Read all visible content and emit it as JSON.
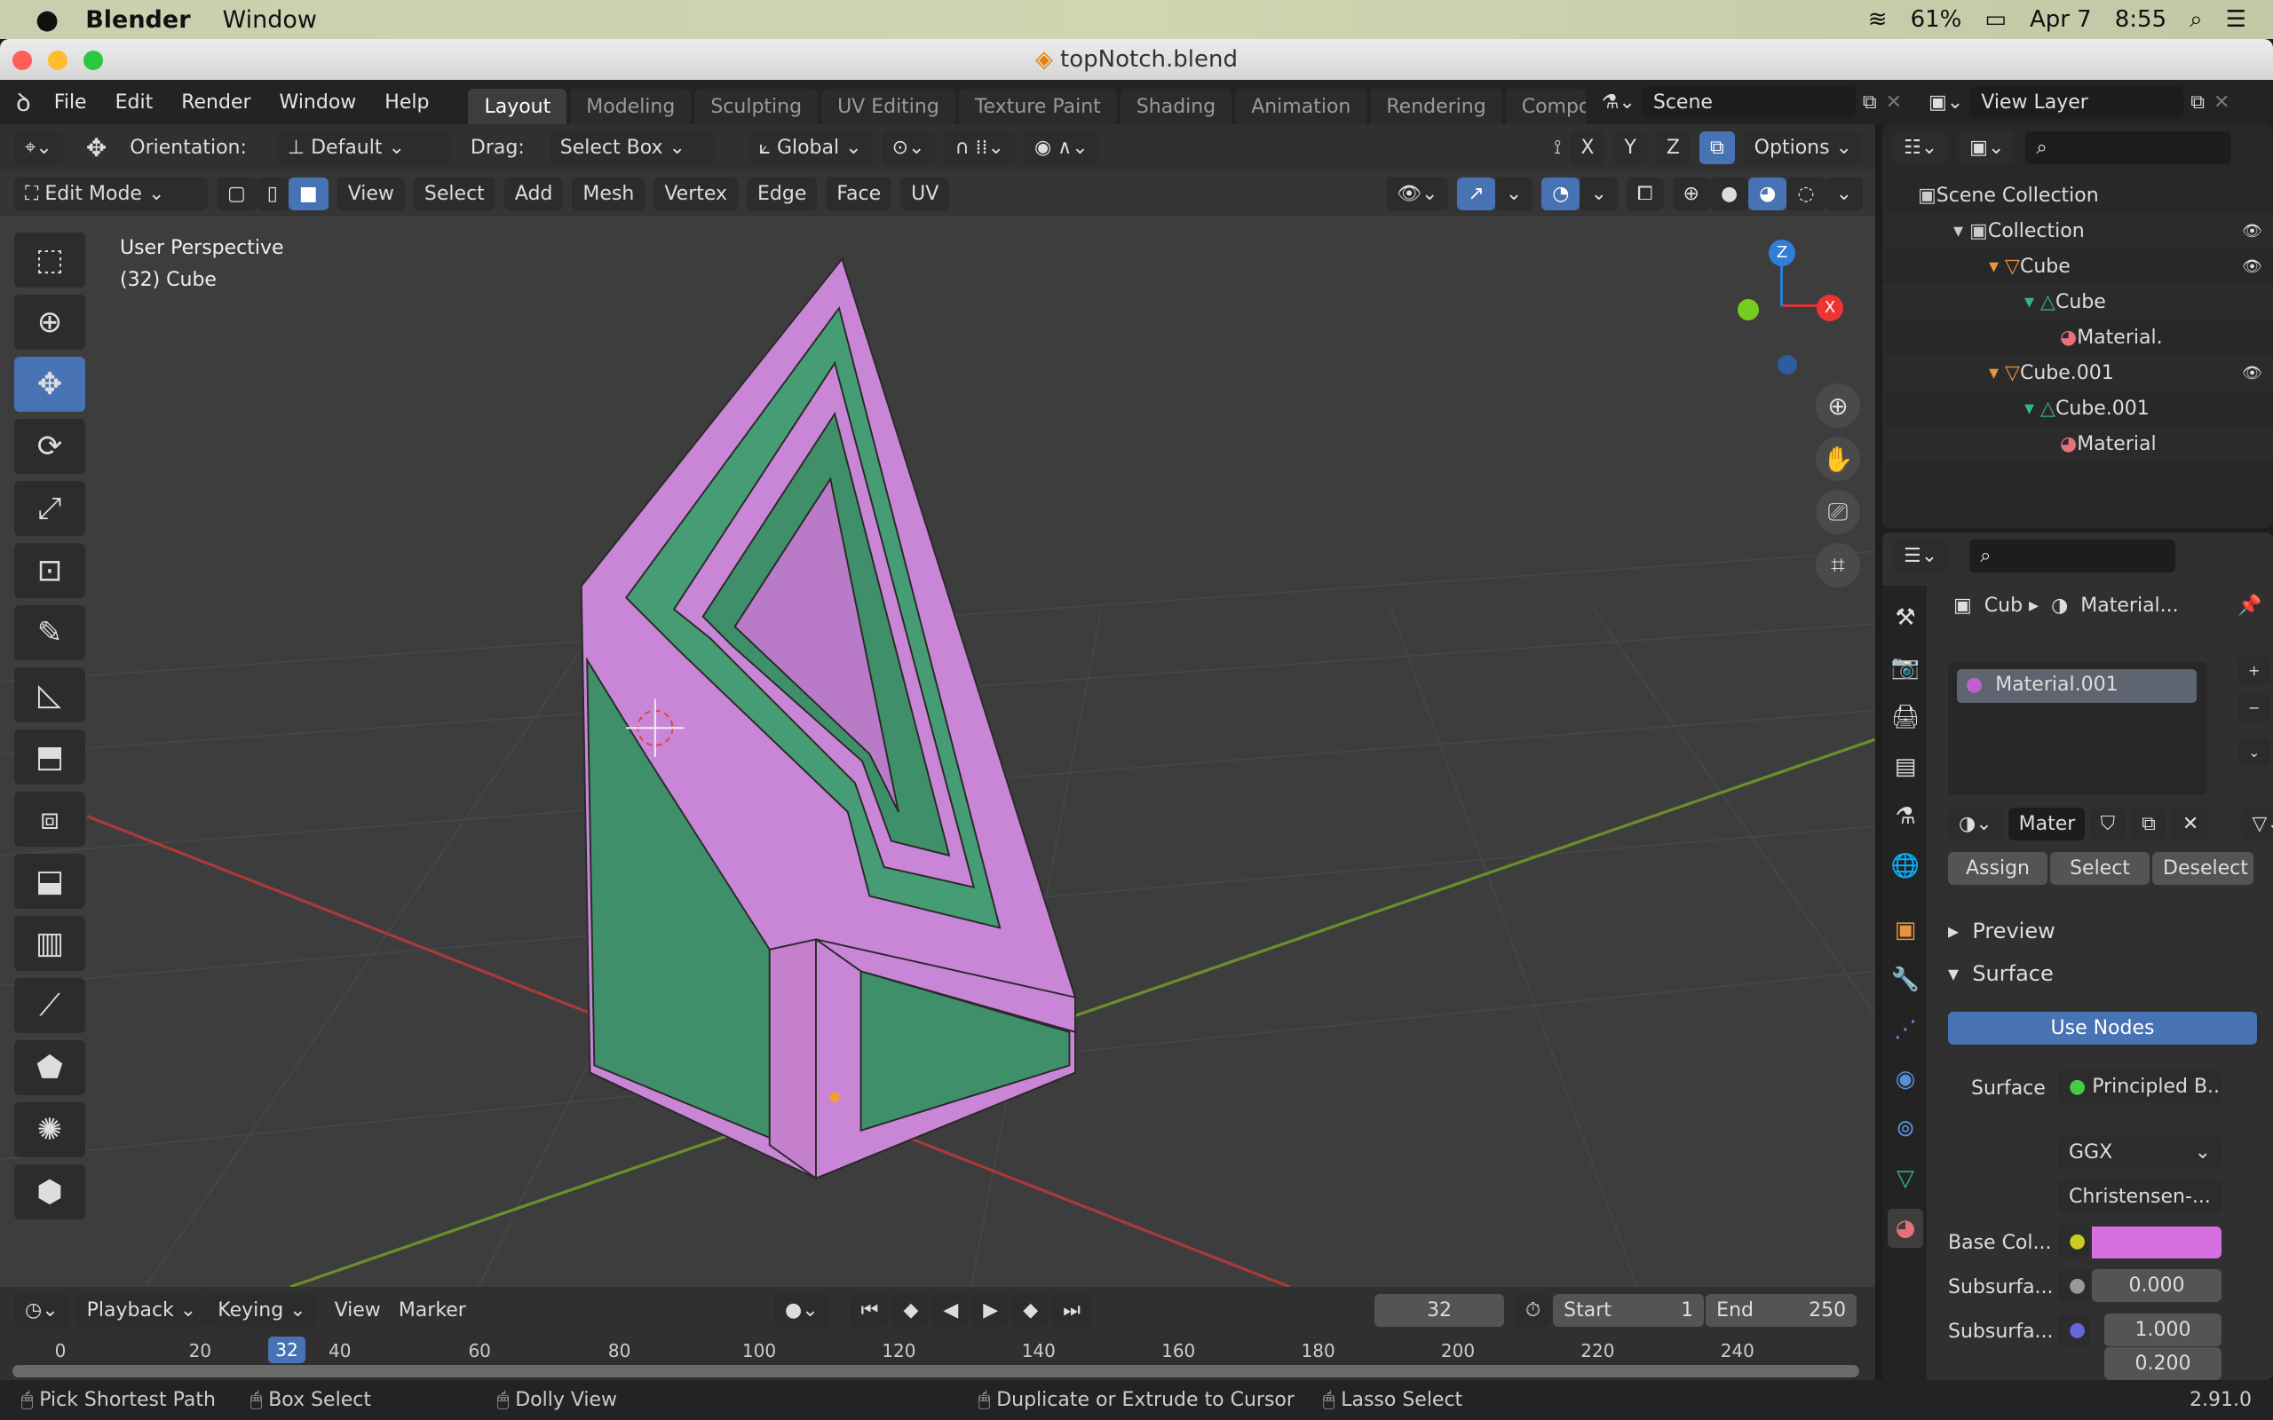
{
  "macos": {
    "app": "Blender",
    "menu": "Window",
    "battery": "61%",
    "date": "Apr 7",
    "time": "8:55"
  },
  "window": {
    "title": "topNotch.blend"
  },
  "topbar": {
    "menus": [
      "File",
      "Edit",
      "Render",
      "Window",
      "Help"
    ],
    "workspaces": [
      "Layout",
      "Modeling",
      "Sculpting",
      "UV Editing",
      "Texture Paint",
      "Shading",
      "Animation",
      "Rendering",
      "Compo"
    ],
    "active_workspace": "Layout",
    "scene": "Scene",
    "view_layer": "View Layer"
  },
  "toolheader": {
    "orientation_label": "Orientation:",
    "orientation": "Default",
    "drag_label": "Drag:",
    "drag": "Select Box",
    "transform": "Global",
    "axes": [
      "X",
      "Y",
      "Z"
    ],
    "options": "Options"
  },
  "viewheader": {
    "mode": "Edit Mode",
    "menus": [
      "View",
      "Select",
      "Add",
      "Mesh",
      "Vertex",
      "Edge",
      "Face",
      "UV"
    ]
  },
  "viewport": {
    "perspective": "User Perspective",
    "object": "(32) Cube",
    "gizmo": {
      "z": "Z",
      "x": "X"
    }
  },
  "outliner": {
    "rows": [
      {
        "label": "Scene Collection",
        "indent": 0
      },
      {
        "label": "Collection",
        "indent": 1
      },
      {
        "label": "Cube",
        "indent": 2
      },
      {
        "label": "Cube",
        "indent": 3
      },
      {
        "label": "Material.",
        "indent": 4
      },
      {
        "label": "Cube.001",
        "indent": 2
      },
      {
        "label": "Cube.001",
        "indent": 3
      },
      {
        "label": "Material",
        "indent": 4
      }
    ]
  },
  "properties": {
    "object": "Cub",
    "material_crumb": "Material...",
    "slot": "Material.001",
    "mat_name": "Mater",
    "assign": "Assign",
    "select": "Select",
    "deselect": "Deselect",
    "preview": "Preview",
    "surface_panel": "Surface",
    "use_nodes": "Use Nodes",
    "surface_label": "Surface",
    "surface_value": "Principled B...",
    "distribution": "GGX",
    "subsurface_method": "Christensen-...",
    "base_color_label": "Base Col...",
    "base_color": "#d670e0",
    "subsurface_label": "Subsurfa...",
    "subsurface": "0.000",
    "subsurface_radius_label": "Subsurfa...",
    "radius1": "1.000",
    "radius2": "0.200"
  },
  "timeline": {
    "menus": [
      "Playback",
      "Keying",
      "View",
      "Marker"
    ],
    "current": "32",
    "start_label": "Start",
    "start": "1",
    "end_label": "End",
    "end": "250",
    "ticks": [
      "0",
      "20",
      "40",
      "60",
      "80",
      "100",
      "120",
      "140",
      "160",
      "180",
      "200",
      "220",
      "240"
    ]
  },
  "status": {
    "items": [
      "Pick Shortest Path",
      "Box Select",
      "Dolly View",
      "Duplicate or Extrude to Cursor",
      "Lasso Select"
    ],
    "version": "2.91.0"
  },
  "colors": {
    "accent": "#4772b3",
    "mesh_face": "#3f8f6a",
    "mesh_edge_sel": "#c98ad0"
  }
}
